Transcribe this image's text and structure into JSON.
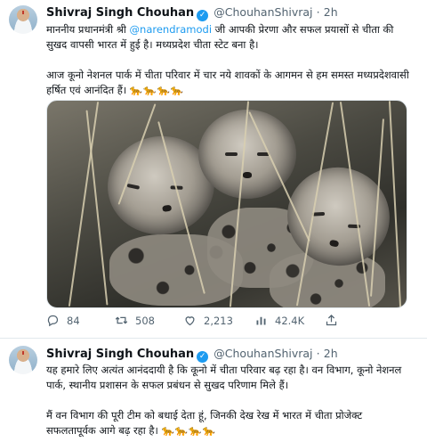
{
  "tweet1": {
    "author_name": "Shivraj Singh Chouhan",
    "verified_glyph": "✓",
    "handle": "@ChouhanShivraj",
    "separator": "·",
    "time": "2h",
    "para1_before": "माननीय प्रधानमंत्री श्री ",
    "para1_mention": "@narendramodi",
    "para1_after": " जी आपकी प्रेरणा और सफल प्रयासों से चीता की सुखद वापसी भारत में हुई है। मध्यप्रदेश चीता स्टेट बना है।",
    "para2": "आज कूनो नेशनल पार्क में चीता परिवार में चार नये शावकों के आगमन से हम समस्त मध्यप्रदेशवासी हर्षित एवं आनंदित हैं।",
    "para2_emoji": "🐆🐆🐆🐆",
    "media_alt": "Cheetah cubs",
    "replies": "84",
    "retweets": "508",
    "likes": "2,213",
    "views": "42.4K"
  },
  "tweet2": {
    "author_name": "Shivraj Singh Chouhan",
    "verified_glyph": "✓",
    "handle": "@ChouhanShivraj",
    "separator": "·",
    "time": "2h",
    "para1": "यह हमारे लिए अत्यंत आनंददायी है कि कूनो में चीता परिवार बढ़ रहा है। वन विभाग, कूनो नेशनल पार्क, स्थानीय प्रशासन के सफल प्रबंधन से सुखद परिणाम मिले हैं।",
    "para2": "मैं वन विभाग की पूरी टीम को बधाई देता हूं, जिनकी देख रेख में भारत में चीता प्रोजेक्ट सफलतापूर्वक आगे बढ़ रहा है।",
    "para2_emoji": "🐆🐆🐆🐆"
  },
  "colors": {
    "link": "#1d9bf0",
    "secondary_text": "#536471",
    "divider": "#e1e8ed"
  },
  "icons": [
    "reply-icon",
    "retweet-icon",
    "like-icon",
    "views-icon",
    "share-icon",
    "verified-badge-icon"
  ]
}
